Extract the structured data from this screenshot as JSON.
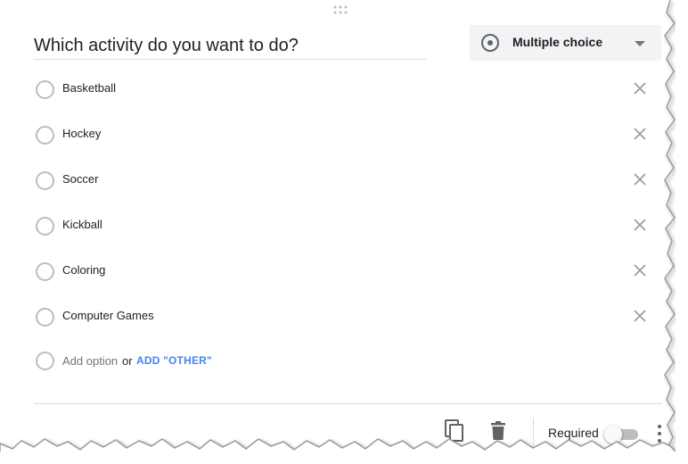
{
  "question": {
    "title": "Which activity do you want to do?"
  },
  "question_type": {
    "label": "Multiple choice",
    "icon": "radio-button-icon"
  },
  "options": [
    {
      "label": "Basketball"
    },
    {
      "label": "Hockey"
    },
    {
      "label": "Soccer"
    },
    {
      "label": "Kickball"
    },
    {
      "label": "Coloring"
    },
    {
      "label": "Computer Games"
    }
  ],
  "add_option": {
    "placeholder": "Add option",
    "or_text": "or",
    "add_other_label": "ADD \"OTHER\""
  },
  "footer": {
    "required_label": "Required",
    "required_on": false
  },
  "colors": {
    "accent_link": "#4285f4",
    "icon_gray": "#5f6368",
    "radio_border": "#bdbdbd"
  }
}
